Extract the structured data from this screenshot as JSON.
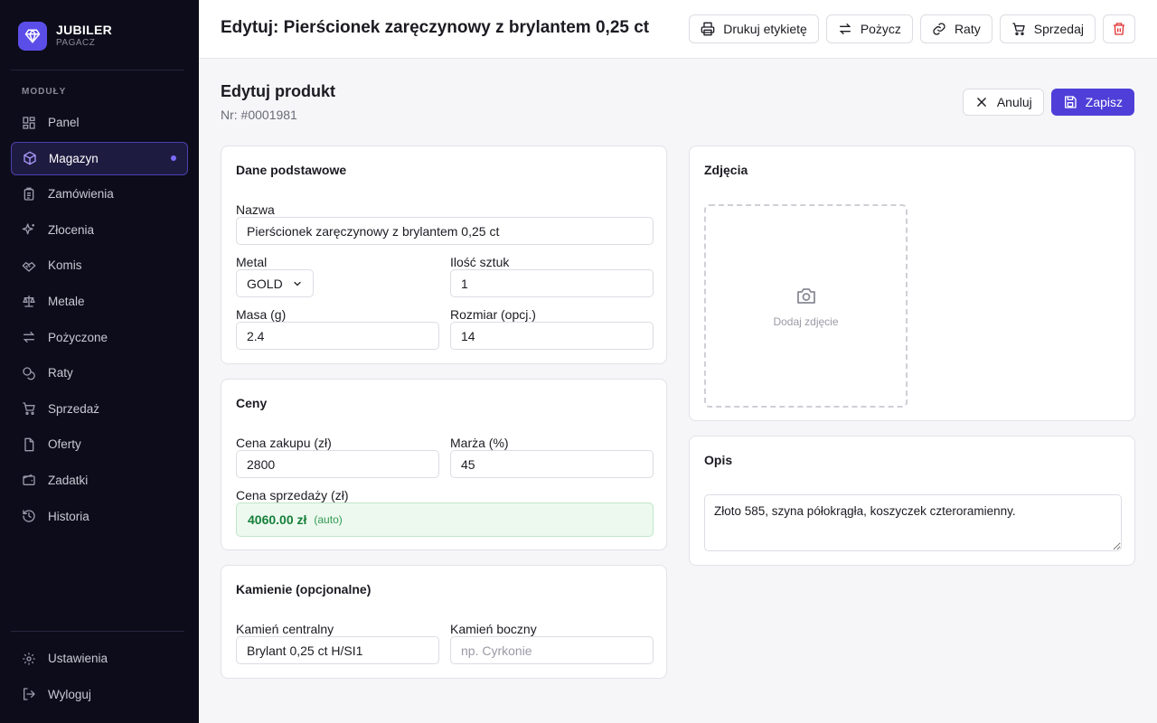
{
  "app": {
    "brand": "JUBILER",
    "user": "PAGACZ"
  },
  "sidebar": {
    "section_label": "MODUŁY",
    "items": [
      {
        "label": "Panel",
        "icon": "dashboard-icon",
        "active": false
      },
      {
        "label": "Magazyn",
        "icon": "box-icon",
        "active": true
      },
      {
        "label": "Zamówienia",
        "icon": "clipboard-icon",
        "active": false
      },
      {
        "label": "Złocenia",
        "icon": "sparkle-icon",
        "active": false
      },
      {
        "label": "Komis",
        "icon": "handshake-icon",
        "active": false
      },
      {
        "label": "Metale",
        "icon": "scale-icon",
        "active": false
      },
      {
        "label": "Pożyczone",
        "icon": "arrows-icon",
        "active": false
      },
      {
        "label": "Raty",
        "icon": "coins-icon",
        "active": false
      },
      {
        "label": "Sprzedaż",
        "icon": "cart-icon",
        "active": false
      },
      {
        "label": "Oferty",
        "icon": "file-icon",
        "active": false
      },
      {
        "label": "Zadatki",
        "icon": "wallet-icon",
        "active": false
      },
      {
        "label": "Historia",
        "icon": "history-icon",
        "active": false
      }
    ],
    "bottom": [
      {
        "label": "Ustawienia",
        "icon": "gear-icon"
      },
      {
        "label": "Wyloguj",
        "icon": "logout-icon"
      }
    ]
  },
  "header": {
    "title": "Edytuj: Pierścionek zaręczynowy z brylantem 0,25 ct",
    "actions": {
      "print": "Drukuj etykietę",
      "lend": "Pożycz",
      "installments": "Raty",
      "sell": "Sprzedaj"
    },
    "delete_color": "#e03131"
  },
  "page": {
    "title": "Edytuj produkt",
    "number": "Nr: #0001981",
    "cancel": "Anuluj",
    "save": "Zapisz",
    "accent": "#4f3fd8"
  },
  "basic": {
    "title": "Dane podstawowe",
    "name_label": "Nazwa",
    "name_value": "Pierścionek zaręczynowy z brylantem 0,25 ct",
    "metal_label": "Metal",
    "metal_value": "GOLD",
    "qty_label": "Ilość sztuk",
    "qty_value": "1",
    "mass_label": "Masa (g)",
    "mass_value": "2.4",
    "size_label": "Rozmiar (opcj.)",
    "size_value": "14"
  },
  "prices": {
    "title": "Ceny",
    "purchase_label": "Cena zakupu (zł)",
    "purchase_value": "2800",
    "margin_label": "Marża (%)",
    "margin_value": "45",
    "sale_label": "Cena sprzedaży (zł)",
    "sale_value": "4060.00 zł",
    "sale_note": "(auto)",
    "sale_color": "#17803a"
  },
  "stones": {
    "title": "Kamienie (opcjonalne)",
    "central_label": "Kamień centralny",
    "central_value": "Brylant 0,25 ct H/SI1",
    "side_label": "Kamień boczny",
    "side_placeholder": "np. Cyrkonie"
  },
  "photos": {
    "title": "Zdjęcia",
    "add_label": "Dodaj zdjęcie"
  },
  "description": {
    "title": "Opis",
    "value": "Złoto 585, szyna półokrągła, koszyczek czteroramienny."
  }
}
